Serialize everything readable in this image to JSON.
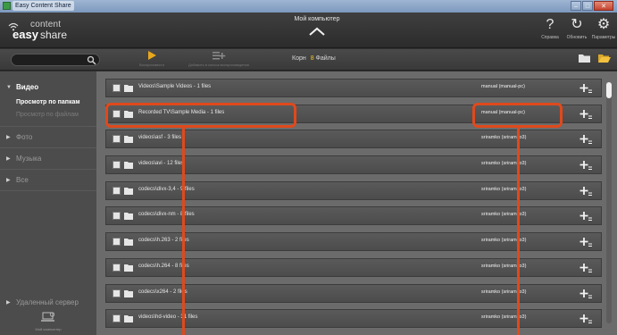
{
  "window": {
    "title": "Easy Content Share",
    "minimize_symbol": "–",
    "maximize_symbol": "□",
    "close_symbol": "✕"
  },
  "app": {
    "logo_word_1": "content",
    "logo_word_2": "easy",
    "logo_word_3": "share"
  },
  "header": {
    "location_label": "Мой компьютер",
    "actions": [
      {
        "icon": "help-icon",
        "glyph": "?",
        "label": "Справка"
      },
      {
        "icon": "refresh-icon",
        "glyph": "↻",
        "label": "Обновить"
      },
      {
        "icon": "settings-icon",
        "glyph": "⚙",
        "label": "Параметры"
      }
    ]
  },
  "toolbar": {
    "search_placeholder": "",
    "play_label": "Воспроизвести",
    "add_label": "Добавить в список воспроизведения",
    "breadcrumb_root": "Корн",
    "breadcrumb_count": "8",
    "breadcrumb_files": "Файлы"
  },
  "sidebar": {
    "video": "Видео",
    "browse_folders": "Просмотр по папкам",
    "browse_files": "Просмотр по файлам",
    "photo": "Фото",
    "music": "Музыка",
    "all": "Все",
    "remote": "Удаленный сервер",
    "device_label": "Мой компьютер"
  },
  "rows": [
    {
      "name": "Videos\\Sample Videos - 1 files",
      "owner": "manual (manual-pc)"
    },
    {
      "name": "Recorded TV\\Sample Media - 1 files",
      "owner": "manual (manual-pc)"
    },
    {
      "name": "videos\\asf - 3 files",
      "owner": "sriramko (sriramko3)"
    },
    {
      "name": "videos\\avi - 12 files",
      "owner": "sriramko (sriramko3)"
    },
    {
      "name": "codecs\\divx-3,4 - 9 files",
      "owner": "sriramko (sriramko3)"
    },
    {
      "name": "codecs\\divx-nm - 8 files",
      "owner": "sriramko (sriramko3)"
    },
    {
      "name": "codecs\\h.263 - 2 files",
      "owner": "sriramko (sriramko3)"
    },
    {
      "name": "codecs\\h.264 - 8 files",
      "owner": "sriramko (sriramko3)"
    },
    {
      "name": "codecs\\x264 - 2 files",
      "owner": "sriramko (sriramko3)"
    },
    {
      "name": "videos\\hd-video - 31 files",
      "owner": "sriramko (sriramko3)"
    }
  ],
  "colors": {
    "accent_yellow": "#f3c61e",
    "callout": "#e0491c"
  },
  "scroll_position": 0
}
